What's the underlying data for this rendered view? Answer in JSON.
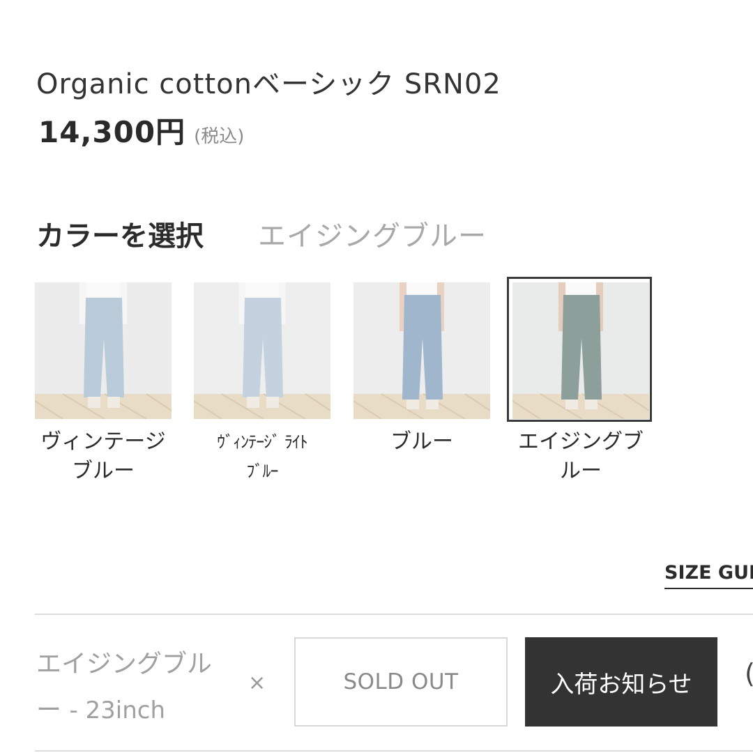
{
  "product": {
    "name": "Organic cottonベーシック SRN02",
    "price": "14,300円",
    "tax_note": "(税込)"
  },
  "color_selector": {
    "heading": "カラーを選択",
    "selected_value": "エイジングブルー",
    "options": [
      {
        "label_line1": "ヴィンテージ",
        "label_line2": "ブルー",
        "denim_color": "#b9cbd9",
        "selected": false
      },
      {
        "label_line1": "ｳﾞｨﾝﾃｰｼﾞ ﾗｲﾄ",
        "label_line2": "ﾌﾞﾙｰ",
        "denim_color": "#c3d2de",
        "selected": false
      },
      {
        "label_line1": "ブルー",
        "label_line2": "",
        "denim_color": "#9fb6cc",
        "selected": false
      },
      {
        "label_line1": "エイジングブ",
        "label_line2": "ルー",
        "denim_color": "#8d9f9a",
        "selected": true
      }
    ]
  },
  "size_guide": {
    "label": "SIZE GUI"
  },
  "variant_row": {
    "name_line1": "エイジングブル",
    "name_line2": "ー",
    "size": "- 23inch",
    "times": "×",
    "soldout_label": "SOLD OUT",
    "notify_label": "入荷お知らせ",
    "edge_glyph": "("
  }
}
